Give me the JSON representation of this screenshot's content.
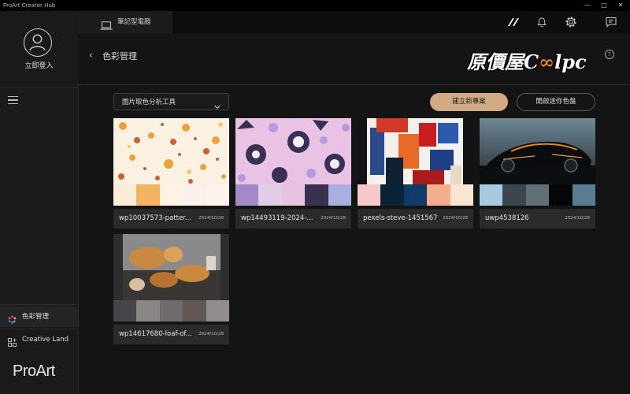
{
  "window": {
    "title": "ProArt Creator Hub"
  },
  "sidebar": {
    "login_label": "立即登入",
    "items": [
      {
        "label": "色彩管理"
      },
      {
        "label": "Creative Land"
      }
    ],
    "brand": "ProArt"
  },
  "topbar": {
    "device_label": "筆記型電腦"
  },
  "header": {
    "title": "色彩管理",
    "watermark_left": "原價屋C",
    "watermark_right": "lpc"
  },
  "toolbar": {
    "dropdown_value": "圖片取色分析工具",
    "new_project_label": "建立新專案",
    "mini_palette_label": "開啟迷你色盤"
  },
  "projects": [
    {
      "name": "wp10037573-patter...",
      "date": "2024/10/28",
      "swatches": [
        "#fbebd9",
        "#f4b360",
        "#fdf2e3",
        "#faf2ea",
        "#fbf3ec"
      ]
    },
    {
      "name": "wp14493119-2024-...",
      "date": "2024/10/28",
      "swatches": [
        "#a488c7",
        "#e0cde6",
        "#e6c3e0",
        "#3a3150",
        "#a9afe0"
      ]
    },
    {
      "name": "pexels-steve-1451567",
      "date": "2024/10/28",
      "swatches": [
        "#f6c8c8",
        "#0a2436",
        "#103a68",
        "#f4ae8e",
        "#fae5d0"
      ]
    },
    {
      "name": "uwp4538126",
      "date": "2024/10/28",
      "swatches": [
        "#a6cbe0",
        "#3c464c",
        "#5e7074",
        "#050607",
        "#5a7c92"
      ]
    },
    {
      "name": "wp14617680-loaf-of...",
      "date": "2024/10/28",
      "swatches": [
        "#47454a",
        "#8a8688",
        "#6f6a6c",
        "#5f5753",
        "#918b8d"
      ]
    }
  ]
}
